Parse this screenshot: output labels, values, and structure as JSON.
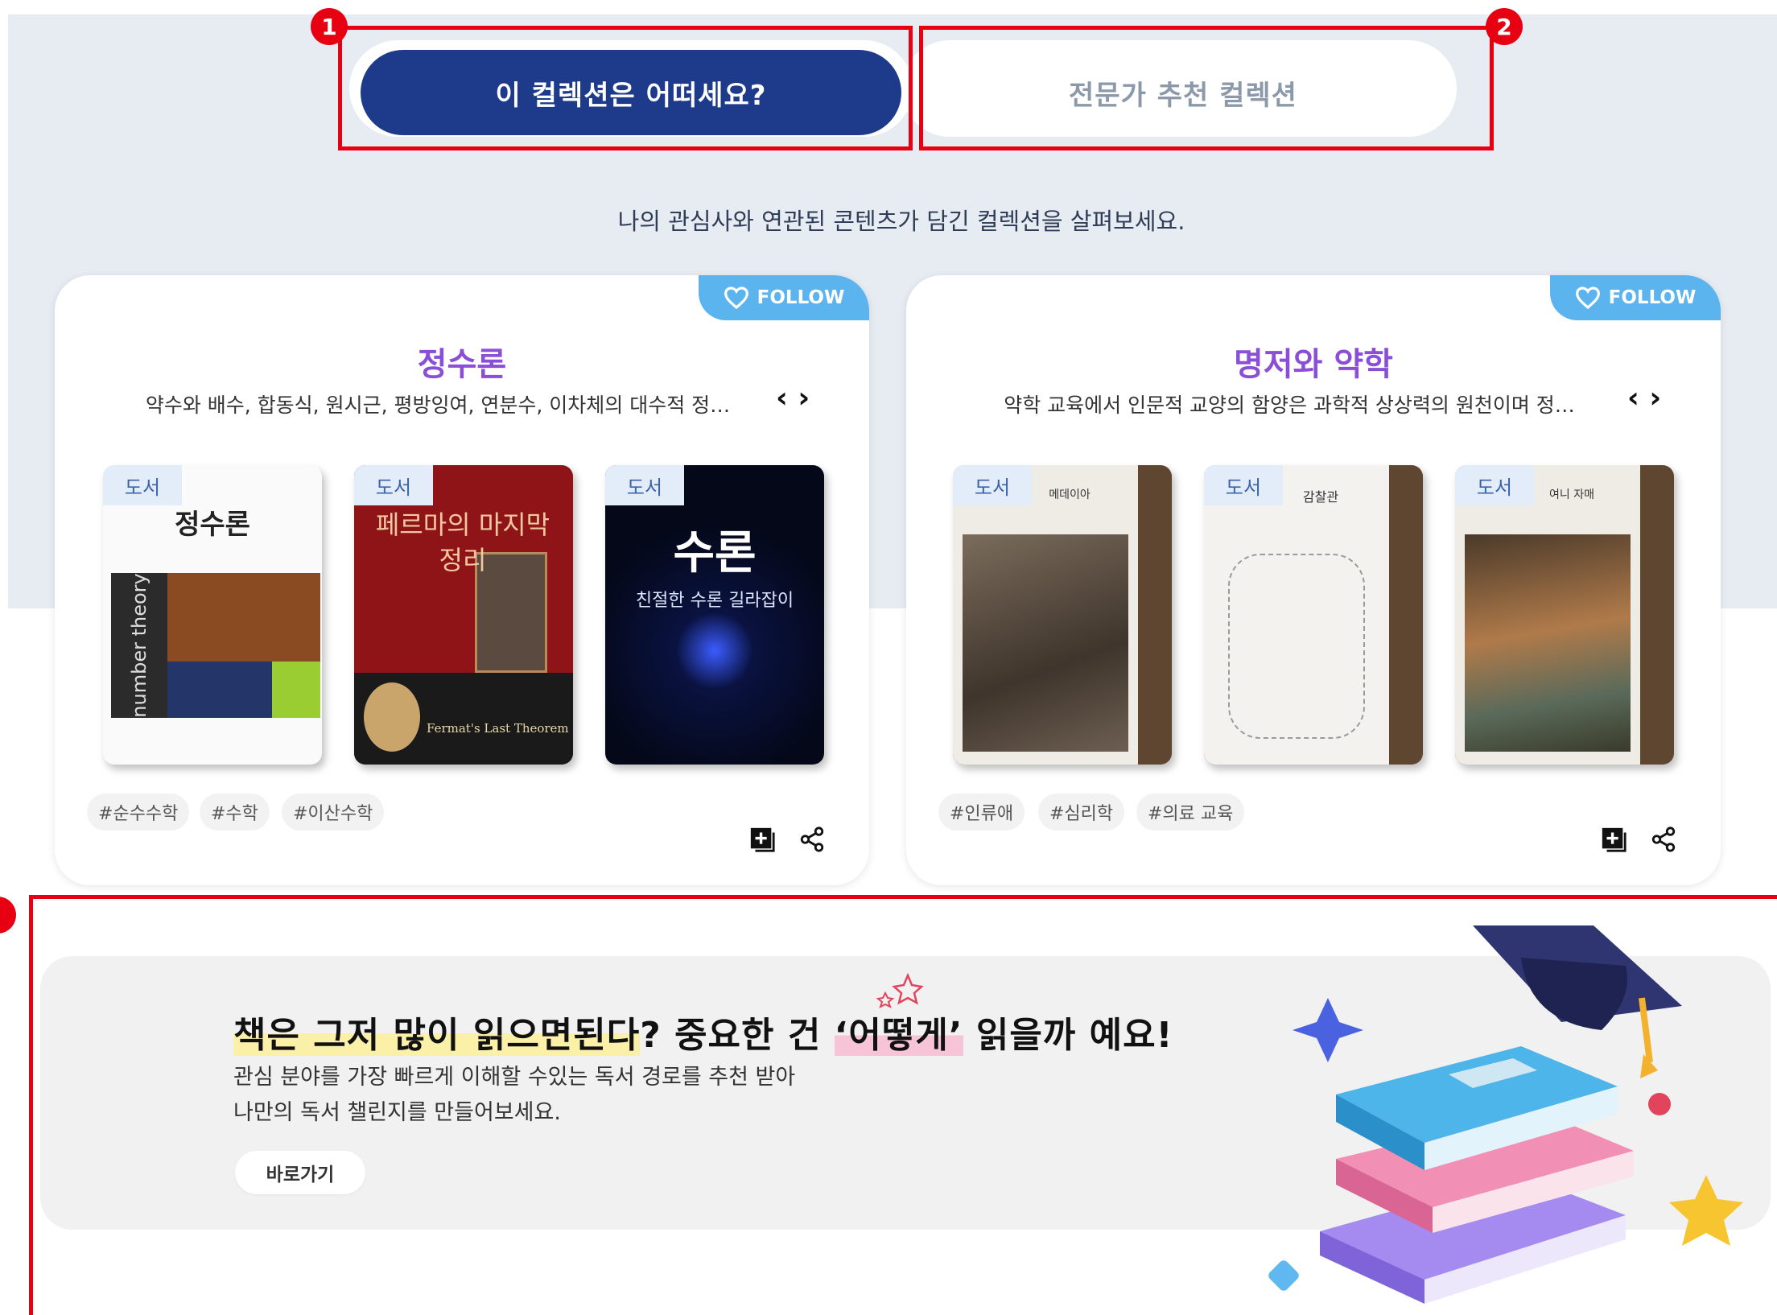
{
  "tabs": [
    {
      "label": "이 컬렉션은 어떠세요?",
      "active": true
    },
    {
      "label": "전문가 추천 컬렉션",
      "active": false
    }
  ],
  "markers": [
    "1",
    "2"
  ],
  "subtitle": "나의 관심사와 연관된 콘텐츠가 담긴 컬렉션을 살펴보세요.",
  "follow_label": "FOLLOW",
  "cards": [
    {
      "title": "정수론",
      "description": "약수와 배수, 합동식, 원시근, 평방잉여, 연분수, 이차체의 대수적 정…",
      "books": [
        {
          "badge": "도서",
          "cover_title": "정수론",
          "cover_text": "number theory"
        },
        {
          "badge": "도서",
          "cover_title": "페르마의 마지막 정리",
          "cover_text": "Fermat's Last Theorem"
        },
        {
          "badge": "도서",
          "cover_title": "수론",
          "cover_text": "친절한 수론 길라잡이"
        }
      ],
      "tags": [
        "#순수수학",
        "#수학",
        "#이산수학"
      ]
    },
    {
      "title": "명저와 약학",
      "description": "약학 교육에서 인문적 교양의 함양은 과학적 상상력의 원천이며 정…",
      "books": [
        {
          "badge": "도서",
          "cover_title": "메데이아"
        },
        {
          "badge": "도서",
          "cover_title": "감찰관"
        },
        {
          "badge": "도서",
          "cover_title": "여니 자매"
        }
      ],
      "tags": [
        "#인류애",
        "#심리학",
        "#의료 교육"
      ]
    }
  ],
  "banner": {
    "headline_1": "책은 그저 많이 읽으면된다",
    "headline_2": "? 중요한 건 ",
    "headline_3": "‘어떻게’",
    "headline_4": " 읽을까 예요!",
    "line1": "관심 분야를 가장 빠르게 이해할 수있는 독서 경로를 추천 받아",
    "line2": "나만의 독서 챌린지를 만들어보세요.",
    "button": "바로가기"
  },
  "colors": {
    "accent_navy": "#1e3a8a",
    "follow_blue": "#5bb4ee",
    "title_purple": "#8a4fd6",
    "annotation_red": "#e60012"
  }
}
